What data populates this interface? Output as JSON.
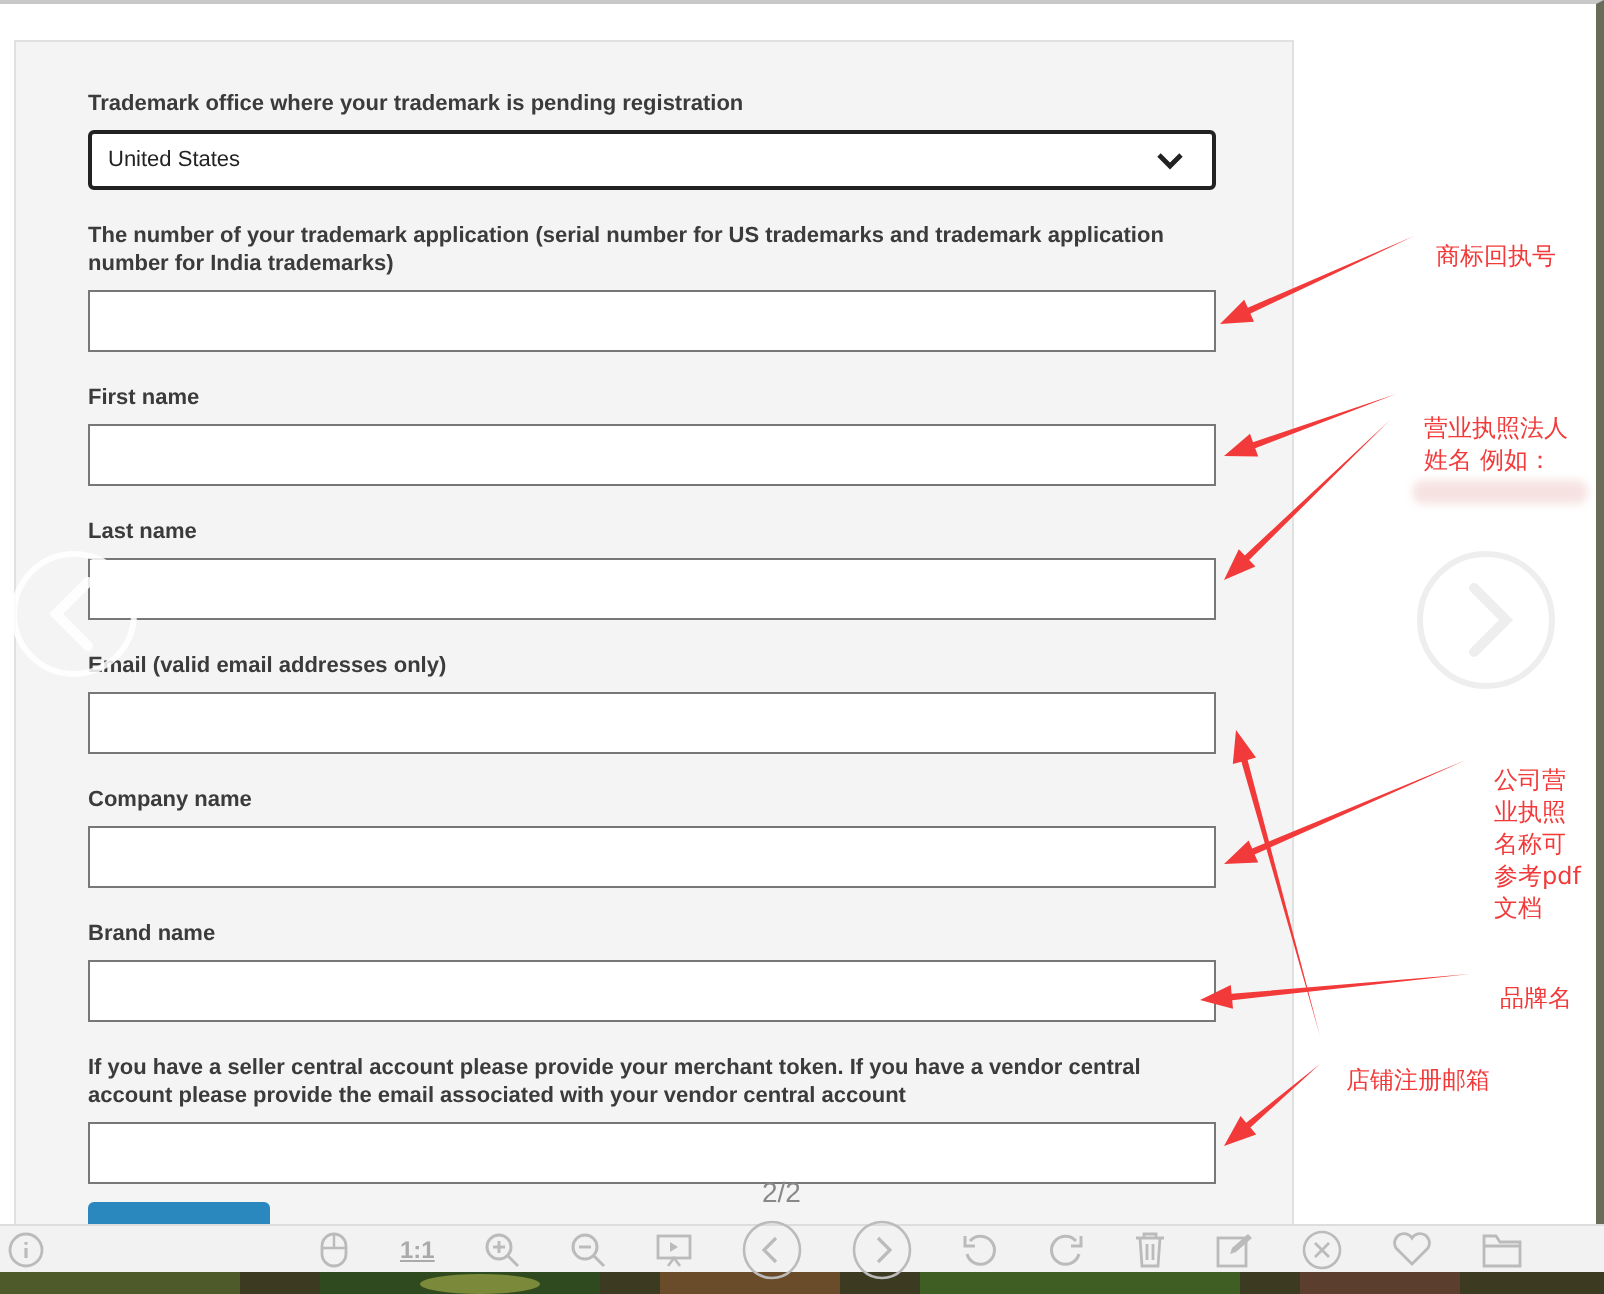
{
  "form": {
    "fields": [
      {
        "kind": "select",
        "label": "Trademark office where your trademark is pending registration",
        "value": "United States"
      },
      {
        "kind": "text",
        "label": "The number of your trademark application (serial number for US trademarks and trademark application number for India trademarks)"
      },
      {
        "kind": "text",
        "label": "First name"
      },
      {
        "kind": "text",
        "label": "Last name"
      },
      {
        "kind": "text",
        "label": "Email (valid email addresses only)"
      },
      {
        "kind": "text",
        "label": "Company name"
      },
      {
        "kind": "text",
        "label": "Brand name"
      },
      {
        "kind": "text",
        "label": "If you have a seller central account please provide your merchant token. If you have a vendor central account please provide the email associated with your vendor central account"
      }
    ]
  },
  "annotations": [
    {
      "lines": [
        "商标回执号"
      ]
    },
    {
      "lines": [
        "营业执照法人",
        "姓名 例如："
      ]
    },
    {
      "lines": [
        "公司营",
        "业执照",
        "名称可",
        "参考pdf",
        "文档"
      ]
    },
    {
      "lines": [
        "品牌名"
      ]
    },
    {
      "lines": [
        "店铺注册邮箱"
      ]
    }
  ],
  "viewer": {
    "page_counter": "2/2",
    "actual_size_label": "1:1"
  }
}
